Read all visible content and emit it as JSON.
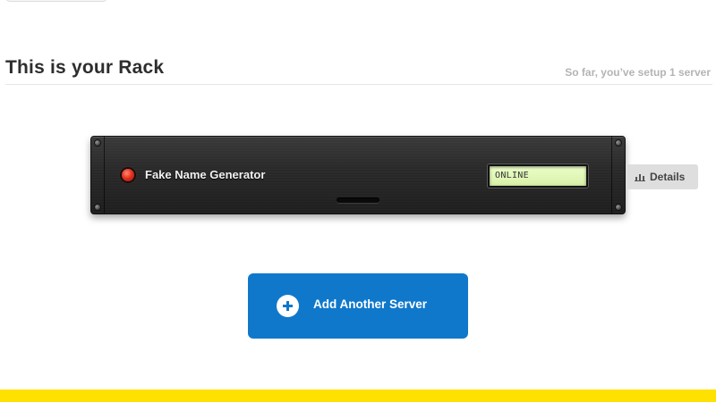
{
  "header": {
    "title": "This is your Rack",
    "server_count_text": "So far, you’ve setup 1 server"
  },
  "rack": {
    "server": {
      "name": "Fake Name Generator",
      "status": "ONLINE",
      "led_color": "#e8321e",
      "details_label": "Details",
      "details_icon": "bar-chart-icon"
    }
  },
  "actions": {
    "add_server_label": "Add Another Server",
    "add_icon": "plus-icon"
  },
  "colors": {
    "accent_blue": "#0f78cb",
    "footer_yellow": "#ffe100",
    "lcd_green": "#d8f0a8"
  }
}
